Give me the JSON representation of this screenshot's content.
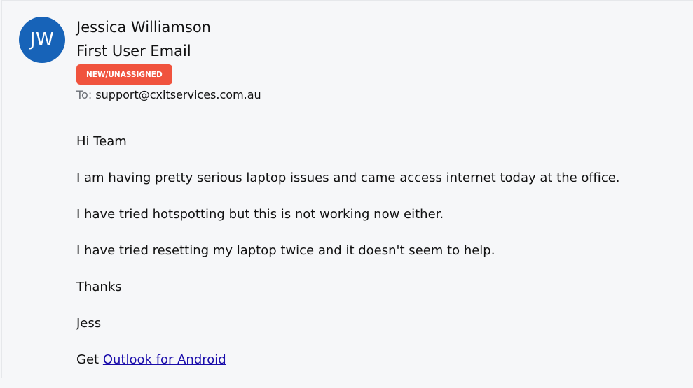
{
  "message": {
    "avatar_initials": "JW",
    "sender_name": "Jessica Williamson",
    "subject": "First User Email",
    "status_badge": "NEW/UNASSIGNED",
    "to_label": "To:",
    "to_address": "support@cxitservices.com.au"
  },
  "body": {
    "greeting": "Hi Team",
    "line1": "I am having pretty serious laptop issues and came access internet today at the office.",
    "line2": "I have tried hotspotting but this is not working now either.",
    "line3": "I have tried resetting my laptop twice and it doesn't seem to help.",
    "thanks": "Thanks",
    "signature": "Jess",
    "footer_prefix": "Get",
    "footer_link": "Outlook for Android"
  },
  "colors": {
    "avatar_bg": "#1763b8",
    "badge_bg": "#f0533e",
    "link": "#1a0dab",
    "page_bg": "#f6f7f9"
  }
}
